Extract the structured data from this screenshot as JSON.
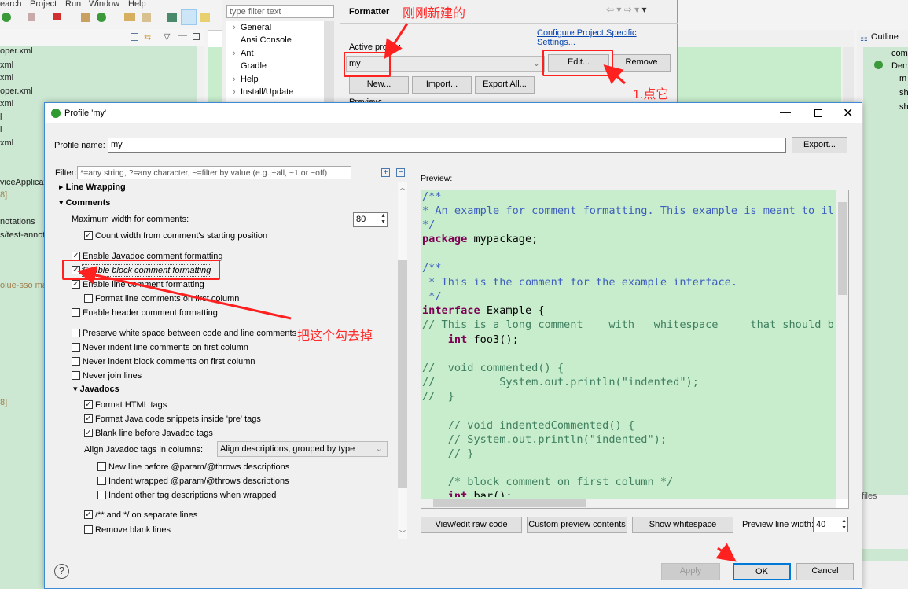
{
  "background": {
    "menu": [
      "earch",
      "Project",
      "Run",
      "Window",
      "Help"
    ],
    "explorer_items": [
      "oper.xml",
      "xml",
      "xml",
      "oper.xml",
      "xml",
      "l",
      "l",
      "xml",
      "viceApplicat",
      "8]",
      "notations",
      "s/test-annot",
      "olue-sso ma",
      "8]"
    ],
    "outline_title": "Outline",
    "outline_items": [
      "com",
      "Dem",
      "m",
      "sh",
      "sh"
    ],
    "bottom_text": "files"
  },
  "preferences": {
    "filter_placeholder": "type filter text",
    "tree": [
      "General",
      "Ansi Console",
      "Ant",
      "Gradle",
      "Help",
      "Install/Update"
    ],
    "title": "Formatter",
    "configure_link": "Configure Project Specific Settings...",
    "active_profile_label": "Active profile:",
    "active_profile_value": "my",
    "edit": "Edit...",
    "remove": "Remove",
    "new": "New...",
    "import": "Import...",
    "export_all": "Export All...",
    "preview_label": "Preview:"
  },
  "dialog": {
    "title": "Profile 'my'",
    "profile_name_label": "Profile name:",
    "profile_name_value": "my",
    "export": "Export...",
    "filter_label": "Filter:",
    "filter_placeholder": "*=any string, ?=any character, ~=filter by value (e.g. ~all, ~1 or ~off)",
    "sections": {
      "line_wrapping": "Line Wrapping",
      "comments": "Comments",
      "javadocs": "Javadocs"
    },
    "max_width_label": "Maximum width for comments:",
    "max_width_value": "80",
    "options": [
      {
        "label": "Count width from comment's starting position",
        "checked": true
      },
      {
        "label": "Enable Javadoc comment formatting",
        "checked": true
      },
      {
        "label": "Enable block comment formatting",
        "checked": true
      },
      {
        "label": "Enable line comment formatting",
        "checked": true
      },
      {
        "label": "Format line comments on first column",
        "checked": false
      },
      {
        "label": "Enable header comment formatting",
        "checked": false
      },
      {
        "label": "Preserve white space between code and line comments",
        "checked": false
      },
      {
        "label": "Never indent line comments on first column",
        "checked": false
      },
      {
        "label": "Never indent block comments on first column",
        "checked": false
      },
      {
        "label": "Never join lines",
        "checked": false
      },
      {
        "label": "Format HTML tags",
        "checked": true
      },
      {
        "label": "Format Java code snippets inside 'pre' tags",
        "checked": true
      },
      {
        "label": "Blank line before Javadoc tags",
        "checked": true
      },
      {
        "label": "New line before @param/@throws descriptions",
        "checked": false
      },
      {
        "label": "Indent wrapped @param/@throws descriptions",
        "checked": false
      },
      {
        "label": "Indent other tag descriptions when wrapped",
        "checked": false
      },
      {
        "label": "/** and */ on separate lines",
        "checked": true
      },
      {
        "label": "Remove blank lines",
        "checked": false
      }
    ],
    "align_label": "Align Javadoc tags in columns:",
    "align_value": "Align descriptions, grouped by type",
    "preview_label": "Preview:",
    "code": [
      [
        [
          "jd",
          "/**"
        ]
      ],
      [
        [
          "jd",
          "* An example for comment formatting. This example is meant to il"
        ]
      ],
      [
        [
          "jd",
          "*/"
        ]
      ],
      [
        [
          "kw",
          "package"
        ],
        [
          "pl",
          " mypackage;"
        ]
      ],
      [],
      [
        [
          "jd",
          "/**"
        ]
      ],
      [
        [
          "jd",
          " * This is the comment for the example interface."
        ]
      ],
      [
        [
          "jd",
          " */"
        ]
      ],
      [
        [
          "kw",
          "interface"
        ],
        [
          "pl",
          " Example {"
        ]
      ],
      [
        [
          "cm",
          "// This is a long comment    with   whitespace     that should b"
        ]
      ],
      [
        [
          "pl",
          "    "
        ],
        [
          "kw",
          "int"
        ],
        [
          "pl",
          " foo3();"
        ]
      ],
      [],
      [
        [
          "cm",
          "//  void commented() {"
        ]
      ],
      [
        [
          "cm",
          "//          System.out.println(\"indented\");"
        ]
      ],
      [
        [
          "cm",
          "//  }"
        ]
      ],
      [],
      [
        [
          "cm",
          "    // void indentedCommented() {"
        ]
      ],
      [
        [
          "cm",
          "    // System.out.println(\"indented\");"
        ]
      ],
      [
        [
          "cm",
          "    // }"
        ]
      ],
      [],
      [
        [
          "cm",
          "    /* block comment on first column */"
        ]
      ],
      [
        [
          "pl",
          "    "
        ],
        [
          "kw",
          "int"
        ],
        [
          "pl",
          " bar();"
        ]
      ]
    ],
    "view_raw": "View/edit raw code",
    "custom_preview": "Custom preview contents",
    "show_whitespace": "Show whitespace",
    "preview_width_label": "Preview line width:",
    "preview_width_value": "40",
    "apply": "Apply",
    "ok": "OK",
    "cancel": "Cancel"
  },
  "annotations": {
    "new_created": "刚刚新建的",
    "click_it": "1.点它",
    "uncheck": "把这个勾去掉"
  },
  "colors": {
    "annotation": "#ff2020",
    "editor_bg": "#c7edcc",
    "javadoc": "#3f5fbf",
    "comment": "#3f7f5f",
    "keyword": "#7f0055",
    "ok_border": "#0078d7"
  }
}
